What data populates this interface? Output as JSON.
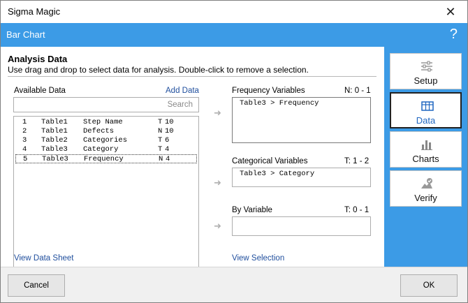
{
  "window": {
    "title": "Sigma Magic",
    "close_glyph": "✕"
  },
  "header": {
    "title": "Bar Chart",
    "help_glyph": "?"
  },
  "analysis": {
    "title": "Analysis Data",
    "subtitle": "Use drag and drop to select data for analysis. Double-click to remove a selection."
  },
  "available": {
    "label": "Available Data",
    "add_link": "Add Data",
    "search_placeholder": "Search",
    "rows": [
      {
        "num": "1",
        "table": "Table1",
        "name": "Step Name",
        "type": "T",
        "count": "10"
      },
      {
        "num": "2",
        "table": "Table1",
        "name": "Defects",
        "type": "N",
        "count": "10"
      },
      {
        "num": "3",
        "table": "Table2",
        "name": "Categories",
        "type": "T",
        "count": "6"
      },
      {
        "num": "4",
        "table": "Table3",
        "name": "Category",
        "type": "T",
        "count": "4"
      },
      {
        "num": "5",
        "table": "Table3",
        "name": "Frequency",
        "type": "N",
        "count": "4"
      }
    ],
    "view_link": "View Data Sheet"
  },
  "frequency": {
    "label": "Frequency Variables",
    "count": "N: 0 - 1",
    "value": "Table3 > Frequency"
  },
  "categorical": {
    "label": "Categorical Variables",
    "count": "T: 1 - 2",
    "value": "Table3 > Category"
  },
  "by_variable": {
    "label": "By Variable",
    "count": "T: 0 - 1",
    "value": ""
  },
  "view_selection": "View Selection",
  "nav": {
    "setup": "Setup",
    "data": "Data",
    "charts": "Charts",
    "verify": "Verify"
  },
  "footer": {
    "cancel": "Cancel",
    "ok": "OK"
  },
  "colors": {
    "accent": "#3c9be6",
    "link": "#1f4e9d",
    "active_nav_text": "#1f66c0"
  },
  "icons": {
    "arrow": "right-arrow-icon",
    "setup": "sliders-icon",
    "data": "table-icon",
    "charts": "bar-chart-icon",
    "verify": "verify-check-icon"
  }
}
